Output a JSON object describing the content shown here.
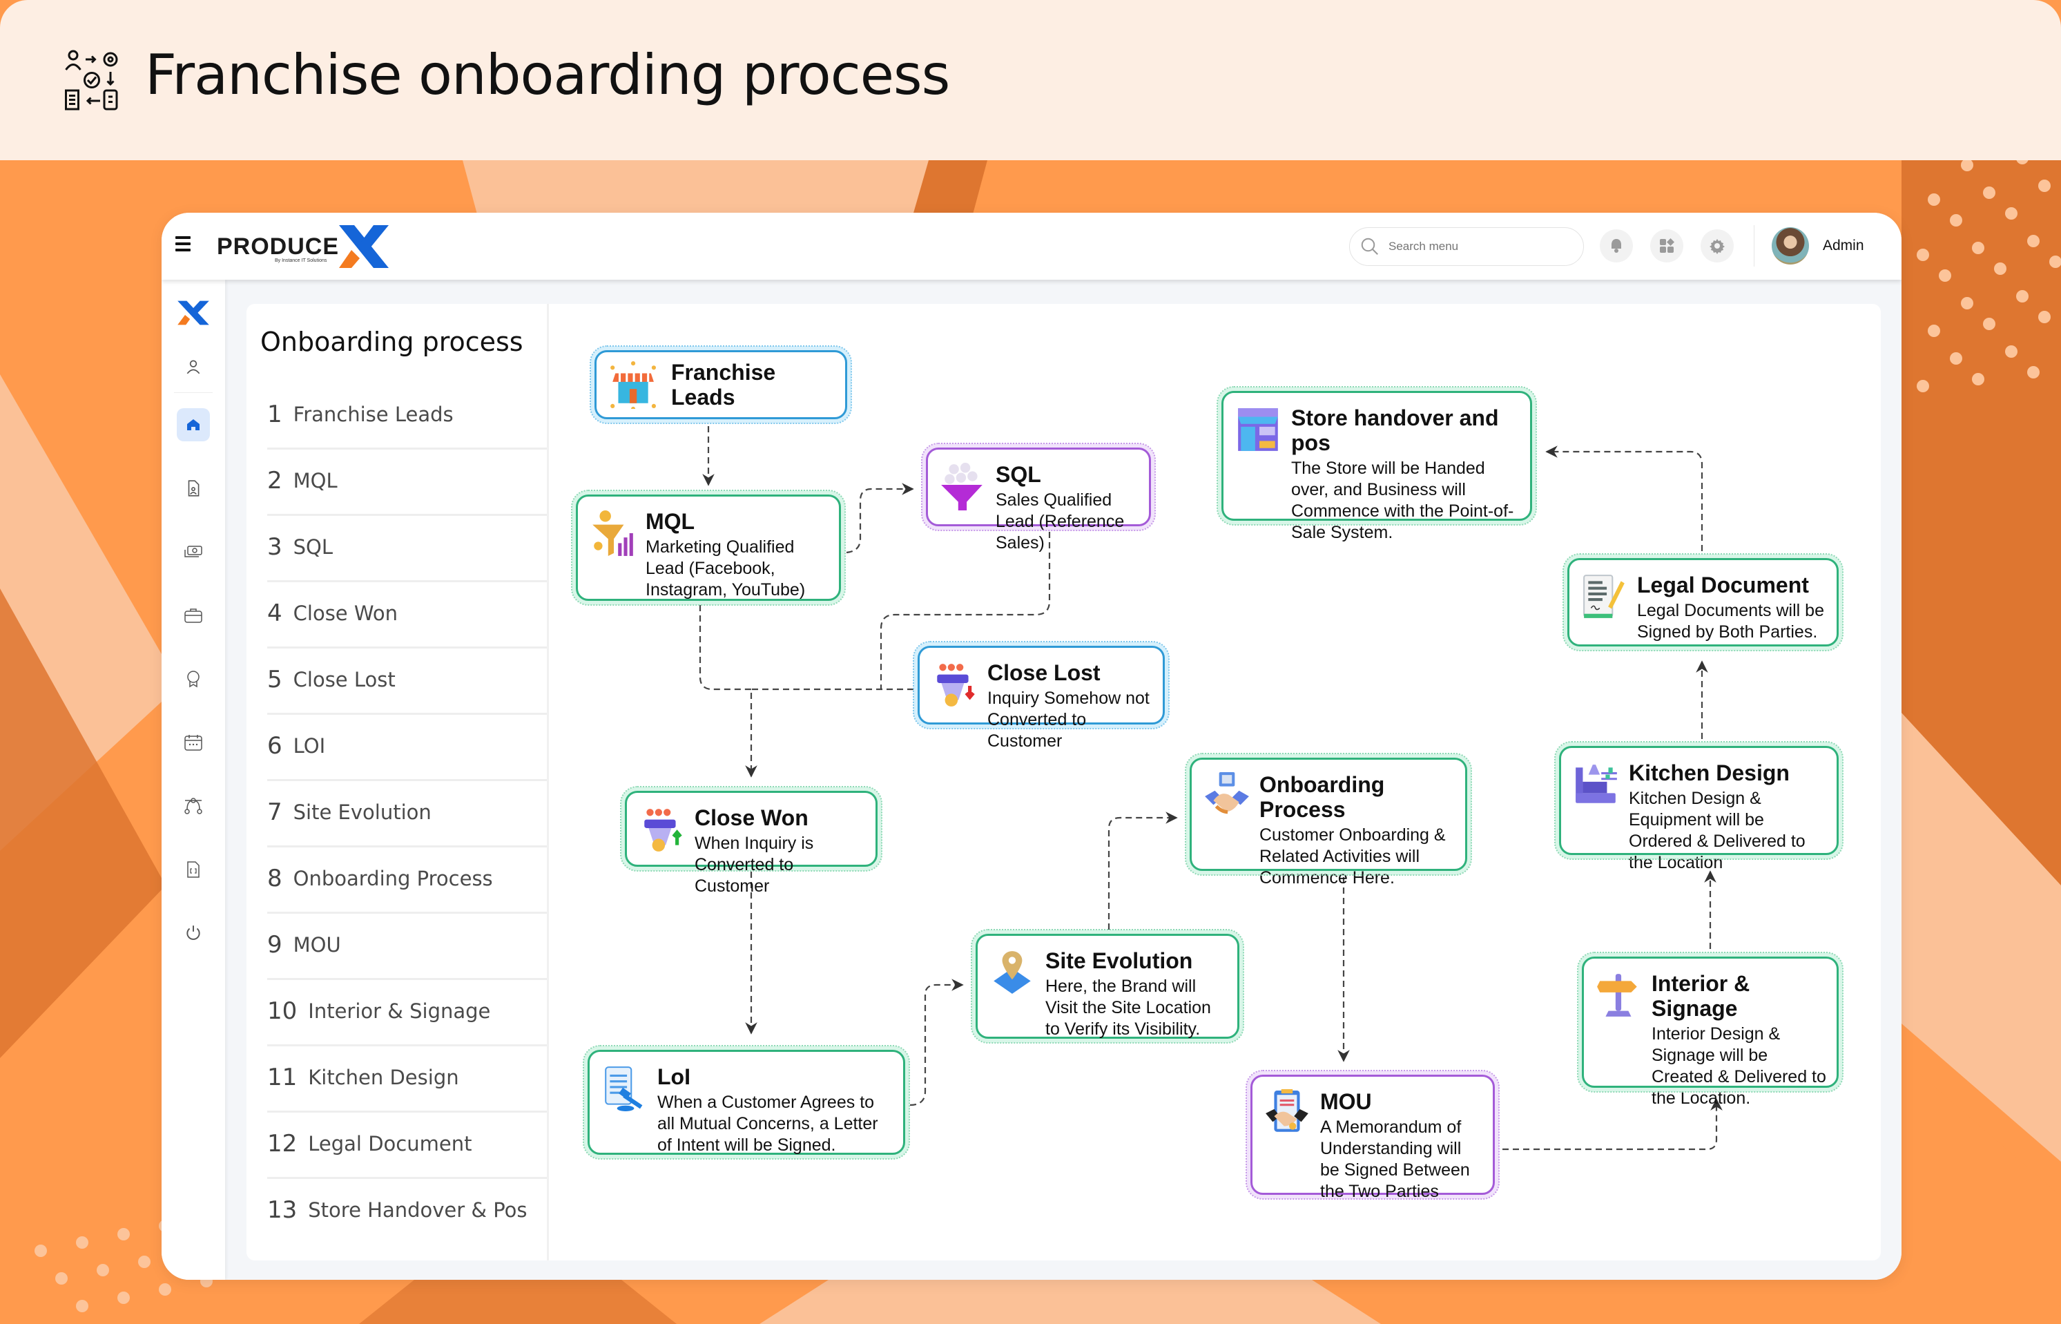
{
  "hero": {
    "title": "Franchise onboarding process",
    "icon": "process-flow-icon"
  },
  "topbar": {
    "menu_icon": "hamburger-icon",
    "logo_text": "PRODUCE",
    "logo_mark": "X",
    "logo_subtitle": "By Instance IT Solutions",
    "search_placeholder": "Search menu",
    "icons": [
      "bell-icon",
      "apps-icon",
      "gear-icon"
    ],
    "user_name": "Admin"
  },
  "rail": {
    "items": [
      {
        "icon": "logo-x-icon",
        "active": false
      },
      {
        "icon": "user-icon",
        "active": false
      },
      {
        "icon": "home-icon",
        "active": true
      },
      {
        "icon": "document-user-icon",
        "active": false
      },
      {
        "icon": "money-icon",
        "active": false
      },
      {
        "icon": "briefcase-icon",
        "active": false
      },
      {
        "icon": "award-icon",
        "active": false
      },
      {
        "icon": "calendar-icon",
        "active": false
      },
      {
        "icon": "flow-icon",
        "active": false
      },
      {
        "icon": "file-code-icon",
        "active": false
      },
      {
        "icon": "power-icon",
        "active": false
      }
    ]
  },
  "steps": {
    "title": "Onboarding process",
    "items": [
      {
        "num": "1",
        "label": "Franchise Leads"
      },
      {
        "num": "2",
        "label": "MQL"
      },
      {
        "num": "3",
        "label": "SQL"
      },
      {
        "num": "4",
        "label": "Close Won"
      },
      {
        "num": "5",
        "label": "Close Lost"
      },
      {
        "num": "6",
        "label": "LOI"
      },
      {
        "num": "7",
        "label": "Site Evolution"
      },
      {
        "num": "8",
        "label": "Onboarding Process"
      },
      {
        "num": "9",
        "label": "MOU"
      },
      {
        "num": "10",
        "label": "Interior & Signage"
      },
      {
        "num": "11",
        "label": "Kitchen Design"
      },
      {
        "num": "12",
        "label": "Legal Document"
      },
      {
        "num": "13",
        "label": "Store Handover & Pos"
      }
    ]
  },
  "diagram": {
    "nodes": [
      {
        "id": "franchise-leads",
        "title": "Franchise Leads",
        "desc": "",
        "color": "blue",
        "icon": "storefront-network-icon"
      },
      {
        "id": "mql",
        "title": "MQL",
        "desc": "Marketing Qualified Lead (Facebook, Instagram, YouTube)",
        "color": "green",
        "icon": "coin-funnel-icon"
      },
      {
        "id": "sql",
        "title": "SQL",
        "desc": "Sales Qualified Lead (Reference Sales)",
        "color": "purple",
        "icon": "people-funnel-icon"
      },
      {
        "id": "close-lost",
        "title": "Close Lost",
        "desc": "Inquiry Somehow not Converted to Customer",
        "color": "blue",
        "icon": "funnel-down-icon"
      },
      {
        "id": "close-won",
        "title": "Close Won",
        "desc": "When Inquiry is Converted to Customer",
        "color": "green",
        "icon": "funnel-up-icon"
      },
      {
        "id": "loi",
        "title": "LoI",
        "desc": "When a Customer Agrees to all Mutual Concerns, a Letter of Intent will be Signed.",
        "color": "green",
        "icon": "document-gavel-icon"
      },
      {
        "id": "site-evolution",
        "title": "Site Evolution",
        "desc": "Here, the Brand will Visit the Site Location to Verify its Visibility.",
        "color": "green",
        "icon": "map-pin-icon"
      },
      {
        "id": "onboarding-process",
        "title": "Onboarding Process",
        "desc": "Customer Onboarding & Related Activities will Commence Here.",
        "color": "green",
        "icon": "handshake-icon"
      },
      {
        "id": "mou",
        "title": "MOU",
        "desc": "A Memorandum of Understanding will be Signed Between the Two Parties",
        "color": "purple",
        "icon": "contract-handshake-icon"
      },
      {
        "id": "interior-signage",
        "title": "Interior & Signage",
        "desc": "Interior Design & Signage will be Created & Delivered to the Location.",
        "color": "green",
        "icon": "signpost-icon"
      },
      {
        "id": "kitchen-design",
        "title": "Kitchen Design",
        "desc": "Kitchen Design & Equipment will be Ordered & Delivered to the Location",
        "color": "green",
        "icon": "kitchen-icon"
      },
      {
        "id": "legal-document",
        "title": "Legal Document",
        "desc": "Legal Documents will be Signed by Both Parties.",
        "color": "green",
        "icon": "signed-document-icon"
      },
      {
        "id": "store-handover",
        "title": "Store handover and pos",
        "desc": "The Store will be Handed over, and Business will Commence with the Point-of-Sale System.",
        "color": "green",
        "icon": "store-icon"
      }
    ],
    "edges": [
      {
        "from": "franchise-leads",
        "to": "mql"
      },
      {
        "from": "mql",
        "to": "sql"
      },
      {
        "from": "mql",
        "to": "close-won"
      },
      {
        "from": "sql",
        "to": "close-won"
      },
      {
        "from": "close-lost",
        "to": "close-won"
      },
      {
        "from": "close-won",
        "to": "loi"
      },
      {
        "from": "loi",
        "to": "site-evolution"
      },
      {
        "from": "site-evolution",
        "to": "onboarding-process"
      },
      {
        "from": "onboarding-process",
        "to": "mou"
      },
      {
        "from": "mou",
        "to": "interior-signage"
      },
      {
        "from": "interior-signage",
        "to": "kitchen-design"
      },
      {
        "from": "kitchen-design",
        "to": "legal-document"
      },
      {
        "from": "legal-document",
        "to": "store-handover"
      }
    ]
  },
  "colors": {
    "hero_bg": "#FDEEE3",
    "orange": "#FF9A4D",
    "orange_light": "#FBC197",
    "orange_dark": "#DE7630",
    "brand_blue": "#1565D8",
    "node_green": "#2FB27C",
    "node_blue": "#2F9AD6",
    "node_purple": "#A45BD8"
  }
}
